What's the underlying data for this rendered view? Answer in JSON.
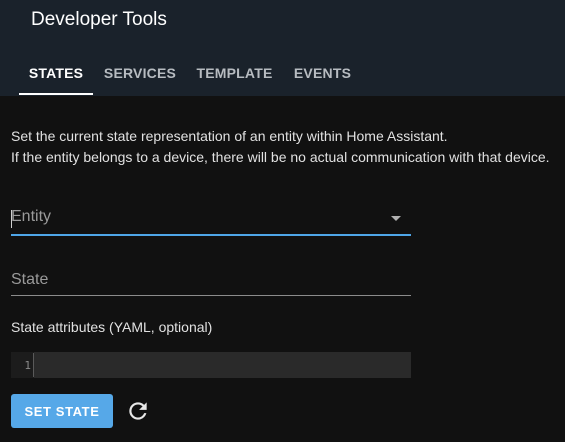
{
  "header": {
    "title": "Developer Tools",
    "tabs": [
      {
        "label": "STATES",
        "active": true
      },
      {
        "label": "SERVICES",
        "active": false
      },
      {
        "label": "TEMPLATE",
        "active": false
      },
      {
        "label": "EVENTS",
        "active": false
      }
    ]
  },
  "main": {
    "description_line1": "Set the current state representation of an entity within Home Assistant.",
    "description_line2": "If the entity belongs to a device, there will be no actual communication with that device.",
    "entity_field": {
      "label": "Entity",
      "icon": "dropdown-arrow-icon"
    },
    "state_field": {
      "label": "State"
    },
    "attributes_label": "State attributes (YAML, optional)",
    "editor": {
      "line_number": "1"
    },
    "set_state_label": "SET STATE",
    "refresh_icon": "refresh-icon"
  },
  "colors": {
    "header_bg": "#1a222b",
    "page_bg": "#111111",
    "accent": "#56a8e8"
  }
}
